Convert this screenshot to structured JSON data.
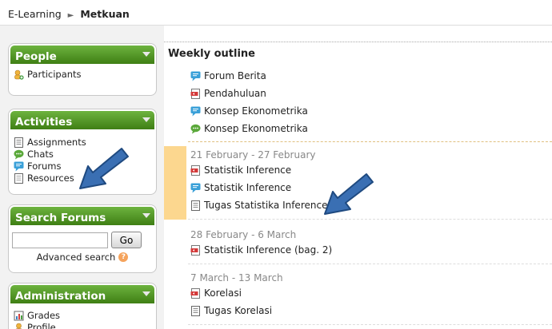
{
  "breadcrumb": {
    "root": "E-Learning",
    "separator": "►",
    "current": "Metkuan"
  },
  "blocks": {
    "people": {
      "title": "People",
      "items": [
        {
          "label": "Participants",
          "icon": "participants-icon"
        }
      ]
    },
    "activities": {
      "title": "Activities",
      "items": [
        {
          "label": "Assignments",
          "icon": "assignment-icon"
        },
        {
          "label": "Chats",
          "icon": "chat-icon"
        },
        {
          "label": "Forums",
          "icon": "forum-icon"
        },
        {
          "label": "Resources",
          "icon": "resource-icon"
        }
      ]
    },
    "search": {
      "title": "Search Forums",
      "input_value": "",
      "button_label": "Go",
      "advanced_label": "Advanced search"
    },
    "administration": {
      "title": "Administration",
      "items": [
        {
          "label": "Grades",
          "icon": "grades-icon"
        },
        {
          "label": "Profile",
          "icon": "profile-icon"
        }
      ]
    }
  },
  "main": {
    "title": "Weekly outline",
    "sections": [
      {
        "date": "",
        "activities": [
          {
            "label": "Forum Berita",
            "icon": "forum-icon"
          },
          {
            "label": "Pendahuluan",
            "icon": "pdf-icon"
          },
          {
            "label": "Konsep Ekonometrika",
            "icon": "forum-icon"
          },
          {
            "label": "Konsep Ekonometrika",
            "icon": "chat-icon"
          }
        ]
      },
      {
        "date": "21 February - 27 February",
        "current": true,
        "activities": [
          {
            "label": "Statistik Inference",
            "icon": "pdf-icon"
          },
          {
            "label": "Statistik Inference",
            "icon": "forum-icon"
          },
          {
            "label": "Tugas Statistika Inference",
            "icon": "assignment-icon"
          }
        ]
      },
      {
        "date": "28 February - 6 March",
        "activities": [
          {
            "label": "Statistik Inference (bag. 2)",
            "icon": "pdf-icon"
          }
        ]
      },
      {
        "date": "7 March - 13 March",
        "activities": [
          {
            "label": "Korelasi",
            "icon": "pdf-icon"
          },
          {
            "label": "Tugas Korelasi",
            "icon": "assignment-icon"
          }
        ]
      }
    ]
  },
  "colors": {
    "block_header": "#4e9323",
    "current_week": "#fcd78f",
    "arrow": "#3a6fb3"
  }
}
